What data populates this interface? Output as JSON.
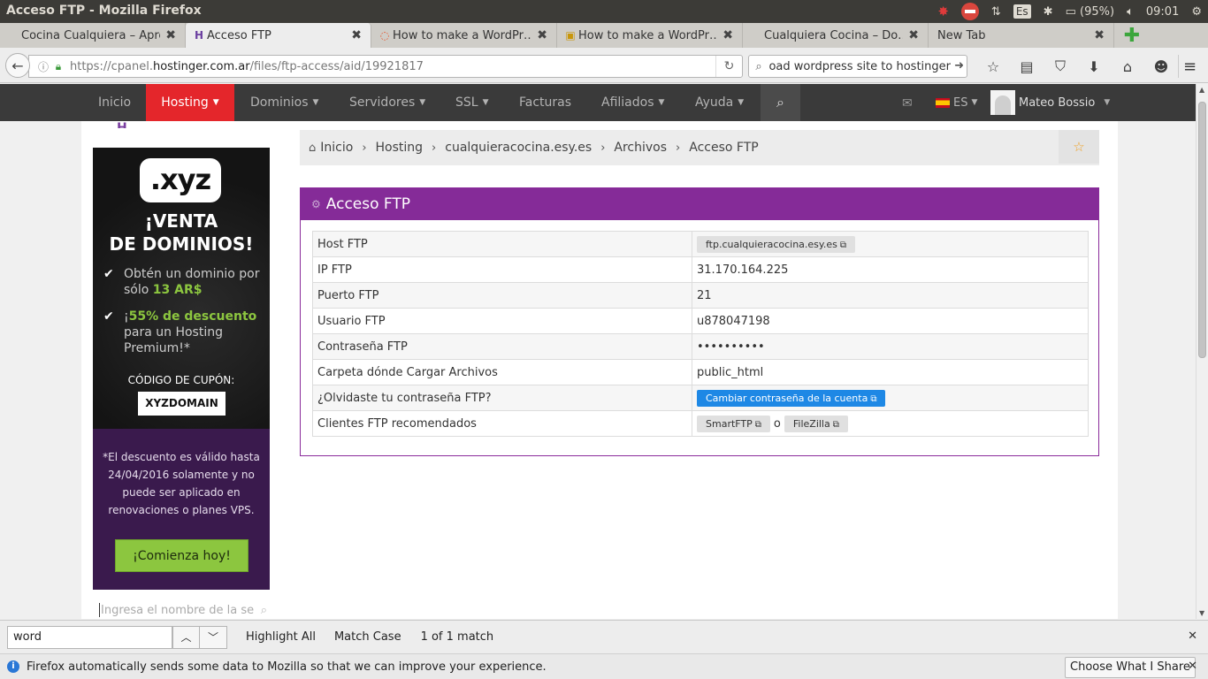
{
  "os": {
    "window_title": "Acceso FTP - Mozilla Firefox",
    "keyboard_layout": "Es",
    "battery": "(95%)",
    "time": "09:01"
  },
  "tabs": [
    {
      "label": "Cocina Cualquiera – Apren…",
      "close": "✖"
    },
    {
      "label": "Acceso FTP",
      "close": "✖"
    },
    {
      "label": "How to make a WordPr…",
      "close": "✖"
    },
    {
      "label": "How to make a WordPr…",
      "close": "✖"
    },
    {
      "label": "Cualquiera Cocina – Do…",
      "close": "✖"
    },
    {
      "label": "New Tab",
      "close": "✖"
    }
  ],
  "nav": {
    "url_prefix": "https://cpanel.",
    "url_domain": "hostinger.com.ar",
    "url_path": "/files/ftp-access/aid/19921817",
    "search_value": "upload wordpress site to hostinger"
  },
  "site_nav": {
    "items": [
      "Inicio",
      "Hosting",
      "Dominios",
      "Servidores",
      "SSL",
      "Facturas",
      "Afiliados",
      "Ayuda"
    ],
    "lang": "ES",
    "user": "Mateo Bossio"
  },
  "promo": {
    "badge": ".xyz",
    "headline_1": "¡VENTA",
    "headline_2": "DE DOMINIOS!",
    "item1_text": "Obtén un dominio por sólo ",
    "item1_highlight": "13 AR$",
    "item2_prefix": "¡",
    "item2_highlight": "55% de descuento",
    "item2_text": " para un Hosting Premium!*",
    "coupon_label": "CÓDIGO DE CUPÓN:",
    "coupon_code": "XYZDOMAIN",
    "note": "*El descuento es válido hasta 24/04/2016 solamente y no puede ser aplicado en renovaciones o planes VPS.",
    "cta": "¡Comienza hoy!"
  },
  "domain_search": {
    "placeholder": "Ingresa el nombre de la se"
  },
  "breadcrumb": {
    "items": [
      "Inicio",
      "Hosting",
      "cualquieracocina.esy.es",
      "Archivos",
      "Acceso FTP"
    ]
  },
  "panel": {
    "title": "Acceso FTP",
    "rows": [
      {
        "label": "Host FTP",
        "value": "ftp.cualquieracocina.esy.es"
      },
      {
        "label": "IP FTP",
        "value": "31.170.164.225"
      },
      {
        "label": "Puerto FTP",
        "value": "21"
      },
      {
        "label": "Usuario FTP",
        "value": "u878047198"
      },
      {
        "label": "Contraseña FTP",
        "value": "••••••••••"
      },
      {
        "label": "Carpeta dónde Cargar Archivos",
        "value": "public_html"
      },
      {
        "label": "¿Olvidaste tu contraseña FTP?",
        "value": "Cambiar contraseña de la cuenta"
      },
      {
        "label": "Clientes FTP recomendados",
        "value": "SmartFTP",
        "separator": "o",
        "value2": "FileZilla"
      }
    ]
  },
  "find_bar": {
    "query": "word",
    "highlight_all": "Highlight All",
    "match_case": "Match Case",
    "status": "1 of 1 match"
  },
  "notification": {
    "text": "Firefox automatically sends some data to Mozilla so that we can improve your experience.",
    "button": "Choose What I Share"
  }
}
